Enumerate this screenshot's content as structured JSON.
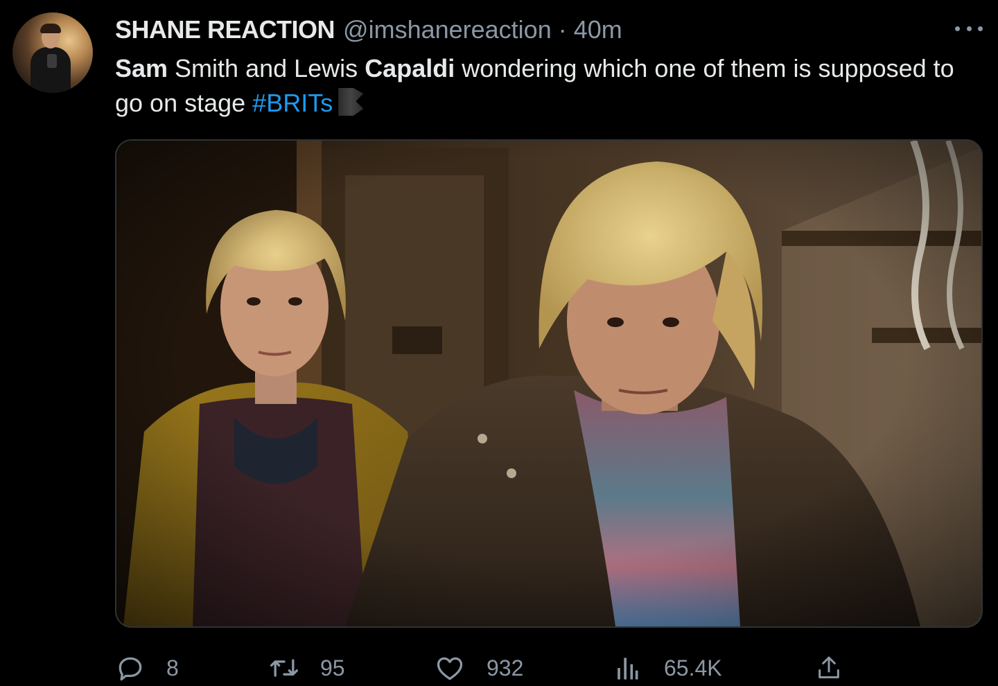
{
  "tweet": {
    "author": {
      "name": "SHANE REACTION",
      "handle": "@imshanereaction",
      "separator": "·",
      "time": "40m"
    },
    "text": {
      "part1_bold": "Sam",
      "part2": " Smith and Lewis ",
      "part3_bold": "Capaldi",
      "part4": " wondering which one of them is supposed to go on stage ",
      "hashtag": "#BRITs"
    },
    "media": {
      "alt": ""
    },
    "actions": {
      "replies": "8",
      "retweets": "95",
      "likes": "932",
      "views": "65.4K"
    }
  },
  "colors": {
    "background": "#000000",
    "text": "#e7e9ea",
    "muted": "#8b98a5",
    "link": "#1d9bf0",
    "border": "#2f3336"
  },
  "icons": [
    "avatar",
    "more-icon",
    "brits-emoji-icon",
    "reply-icon",
    "retweet-icon",
    "like-icon",
    "views-icon",
    "share-icon"
  ]
}
